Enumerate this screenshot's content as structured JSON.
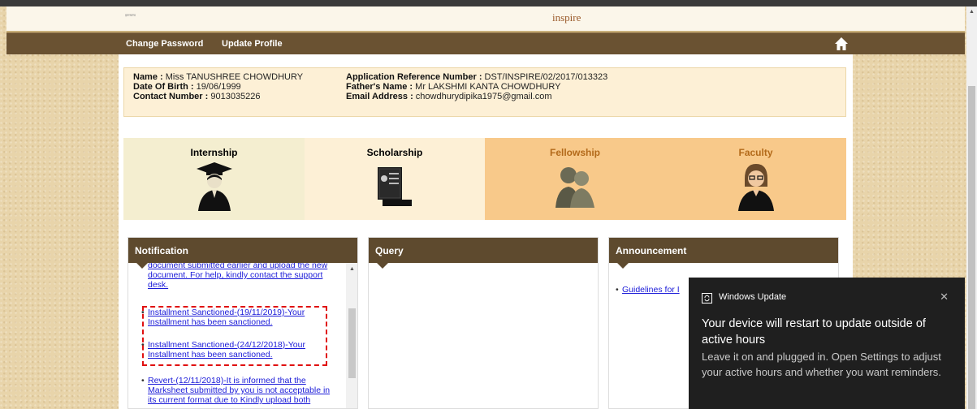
{
  "header": {
    "small_text": "झारखण्ड",
    "logo_text": "inspire"
  },
  "nav": {
    "change_password": "Change Password",
    "update_profile": "Update Profile",
    "home_icon": "home-icon"
  },
  "profile": {
    "name_label": "Name :",
    "name_value": "Miss TANUSHREE CHOWDHURY",
    "dob_label": "Date Of Birth :",
    "dob_value": "19/06/1999",
    "contact_label": "Contact Number :",
    "contact_value": "9013035226",
    "ref_label": "Application Reference Number :",
    "ref_value": "DST/INSPIRE/02/2017/013323",
    "father_label": "Father's Name :",
    "father_value": "Mr LAKSHMI KANTA CHOWDHURY",
    "email_label": "Email Address :",
    "email_value": "chowdhurydipika1975@gmail.com"
  },
  "categories": [
    {
      "label": "Internship",
      "color": "#222222",
      "bg": "#f4eed0",
      "icon": "graduate-icon"
    },
    {
      "label": "Scholarship",
      "color": "#222222",
      "bg": "#fdf0d6",
      "icon": "certificate-icon"
    },
    {
      "label": "Fellowship",
      "color": "#b36a1a",
      "bg": "#f8c98a",
      "icon": "people-icon"
    },
    {
      "label": "Faculty",
      "color": "#b36a1a",
      "bg": "#f8c98a",
      "icon": "teacher-icon"
    }
  ],
  "panels": {
    "notification_title": "Notification",
    "query_title": "Query",
    "announcement_title": "Announcement"
  },
  "notifications": [
    {
      "text": "document submitted earlier and upload the new document. For help, kindly contact the support desk."
    },
    {
      "text": "Installment Sanctioned-(19/11/2019)-Your Installment has been sanctioned."
    },
    {
      "text": "Installment Sanctioned-(24/12/2018)-Your Installment has been sanctioned."
    },
    {
      "text": "Revert-(12/11/2018)-It is informed that the Marksheet submitted by you is not acceptable in its current format due to Kindly upload both"
    }
  ],
  "announcements": [
    {
      "text": "Guidelines for I"
    }
  ],
  "toast": {
    "header": "Windows Update",
    "title": "Your device will restart to update outside of active hours",
    "body": "Leave it on and plugged in. Open Settings to adjust your active hours and whether you want reminders.",
    "close": "✕"
  }
}
